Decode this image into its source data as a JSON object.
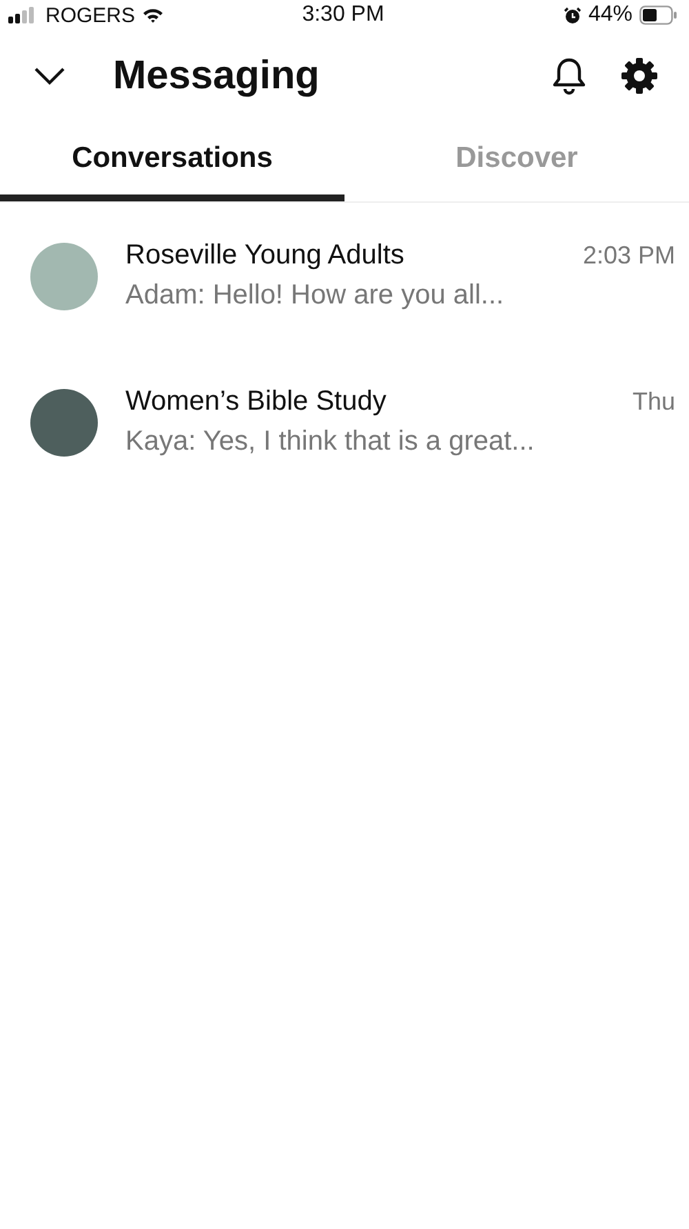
{
  "status_bar": {
    "carrier": "ROGERS",
    "time": "3:30 PM",
    "battery": "44%"
  },
  "header": {
    "title": "Messaging"
  },
  "tabs": [
    {
      "label": "Conversations",
      "selected": true
    },
    {
      "label": "Discover",
      "selected": false
    }
  ],
  "conversations": [
    {
      "name": "Roseville Young Adults",
      "preview": "Adam: Hello! How are you all...",
      "time": "2:03 PM",
      "color": "#a2b8b0"
    },
    {
      "name": "Women’s Bible Study",
      "preview": "Kaya: Yes, I think that is a great...",
      "time": "Thu",
      "color": "#4e5f5d"
    }
  ]
}
